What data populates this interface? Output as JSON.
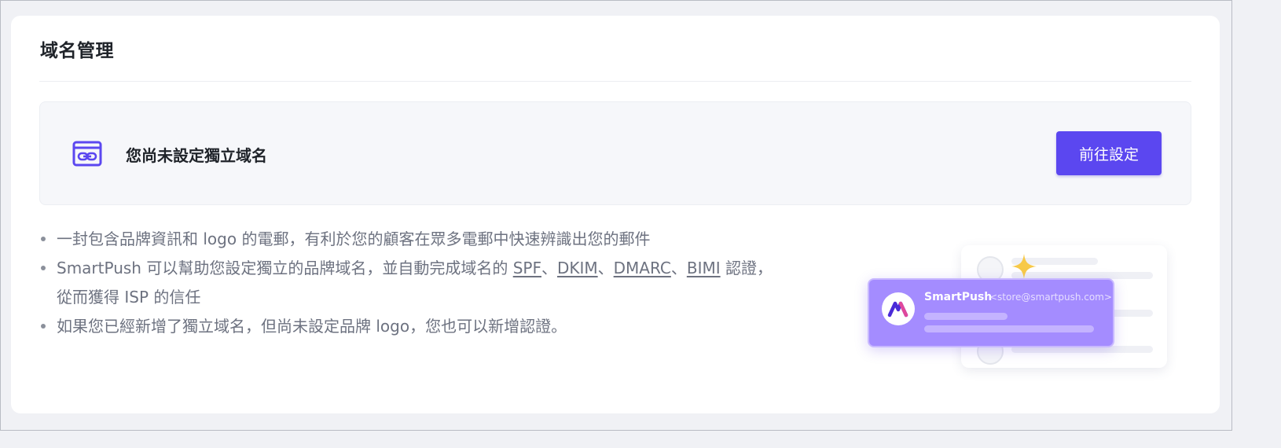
{
  "page": {
    "title": "域名管理"
  },
  "banner": {
    "icon": "link-window-icon",
    "message": "您尚未設定獨立域名",
    "button_label": "前往設定"
  },
  "info": {
    "bullet1": "一封包含品牌資訊和 logo 的電郵，有利於您的顧客在眾多電郵中快速辨識出您的郵件",
    "bullet2": {
      "prefix": "SmartPush 可以幫助您設定獨立的品牌域名，並自動完成域名的 ",
      "links": [
        "SPF",
        "DKIM",
        "DMARC",
        "BIMI"
      ],
      "separator": "、",
      "suffix": " 認證，",
      "line2": "從而獲得 ISP 的信任"
    },
    "bullet3": "如果您已經新增了獨立域名，但尚未設定品牌 logo，您也可以新增認證。"
  },
  "illustration": {
    "sender_name": "SmartPush",
    "sender_email": "<store@smartpush.com>"
  },
  "colors": {
    "accent": "#5b47f0",
    "card_purple": "#a48cff",
    "sparkle": "#f7c948",
    "text_primary": "#1f2329",
    "text_secondary": "#6d7280"
  }
}
